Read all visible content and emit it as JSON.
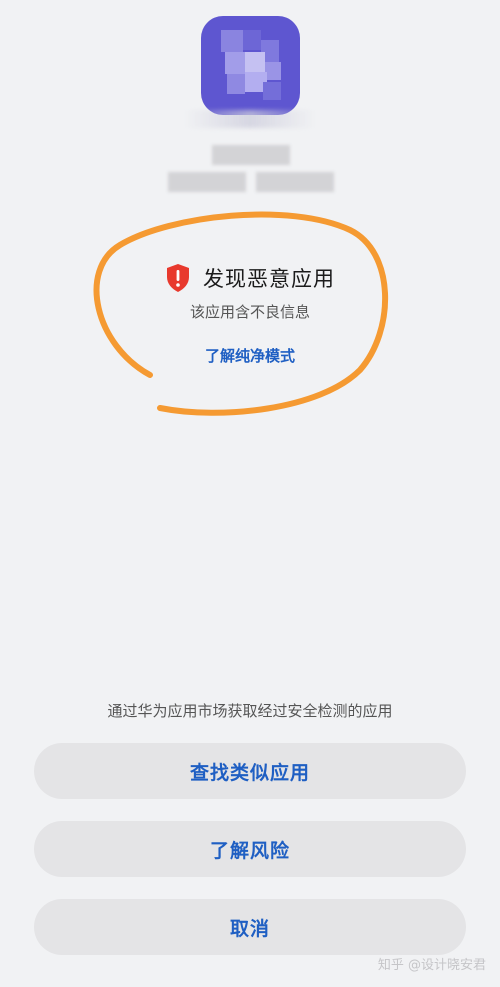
{
  "warning": {
    "title": "发现恶意应用",
    "subtitle": "该应用含不良信息",
    "link": "了解纯净模式"
  },
  "hint": "通过华为应用市场获取经过安全检测的应用",
  "buttons": {
    "find_similar": "查找类似应用",
    "learn_risk": "了解风险",
    "cancel": "取消"
  },
  "watermark": "知乎 @设计晓安君",
  "colors": {
    "background": "#f1f2f4",
    "accent": "#1f5fc3",
    "button_bg": "#e4e4e6",
    "shield": "#e8392d",
    "annotation": "#f59a32"
  }
}
